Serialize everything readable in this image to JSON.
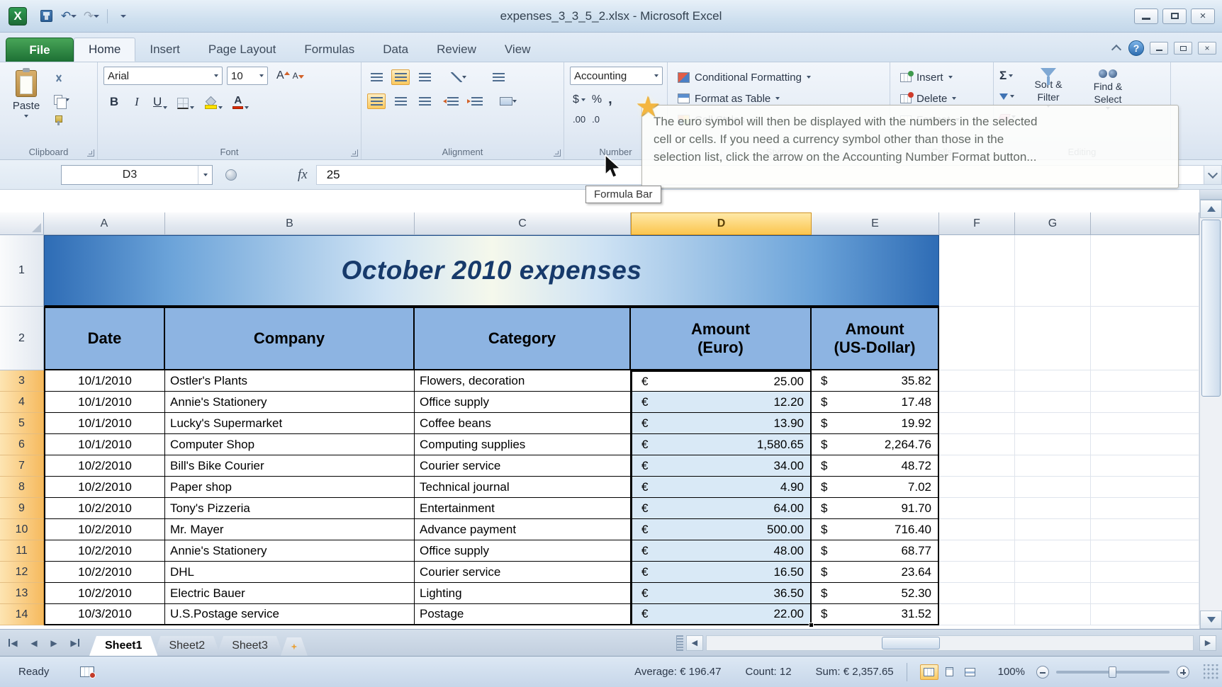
{
  "window": {
    "title": "expenses_3_3_5_2.xlsx  -  Microsoft Excel"
  },
  "tabs": {
    "file": "File",
    "items": [
      "Home",
      "Insert",
      "Page Layout",
      "Formulas",
      "Data",
      "Review",
      "View"
    ]
  },
  "ribbon": {
    "clipboard": {
      "paste": "Paste",
      "label": "Clipboard"
    },
    "font": {
      "name": "Arial",
      "size": "10",
      "bold": "B",
      "italic": "I",
      "underline": "U",
      "label": "Font"
    },
    "alignment": {
      "label": "Alignment"
    },
    "number": {
      "format": "Accounting",
      "currency": "$",
      "percent": "%",
      "comma": ",",
      "inc_decimal": ".00",
      "dec_decimal": ".0",
      "label": "Number"
    },
    "styles": {
      "conditional": "Conditional Formatting",
      "format_table": "Format as Table",
      "cell_styles": "Cell Styles",
      "label": "Styles"
    },
    "cells": {
      "insert": "Insert",
      "delete": "Delete",
      "format": "Format",
      "label": "Cells"
    },
    "editing": {
      "sort_line1": "Sort &",
      "sort_line2": "Filter",
      "find_line1": "Find &",
      "find_line2": "Select",
      "label": "Editing"
    }
  },
  "tip_overlay": {
    "line1": "The euro symbol will then be displayed with the numbers in the selected",
    "line2": "cell or cells. If you need a currency symbol other than those in the",
    "line3": "selection list, click the arrow on the Accounting Number Format button..."
  },
  "formula_bar": {
    "name_box": "D3",
    "fx": "fx",
    "value": "25",
    "tooltip": "Formula Bar"
  },
  "grid": {
    "columns": [
      "A",
      "B",
      "C",
      "D",
      "E",
      "F",
      "G"
    ],
    "title_row": {
      "n": "1",
      "text": "October 2010 expenses"
    },
    "header_row": {
      "n": "2",
      "date": "Date",
      "company": "Company",
      "category": "Category",
      "euro_line1": "Amount",
      "euro_line2": "(Euro)",
      "usd_line1": "Amount",
      "usd_line2": "(US-Dollar)"
    },
    "rows": [
      {
        "n": "3",
        "date": "10/1/2010",
        "company": "Ostler's Plants",
        "category": "Flowers, decoration",
        "eur_sym": "€",
        "eur": "25.00",
        "usd_sym": "$",
        "usd": "35.82"
      },
      {
        "n": "4",
        "date": "10/1/2010",
        "company": "Annie's Stationery",
        "category": "Office supply",
        "eur_sym": "€",
        "eur": "12.20",
        "usd_sym": "$",
        "usd": "17.48"
      },
      {
        "n": "5",
        "date": "10/1/2010",
        "company": "Lucky's Supermarket",
        "category": "Coffee beans",
        "eur_sym": "€",
        "eur": "13.90",
        "usd_sym": "$",
        "usd": "19.92"
      },
      {
        "n": "6",
        "date": "10/1/2010",
        "company": "Computer Shop",
        "category": "Computing supplies",
        "eur_sym": "€",
        "eur": "1,580.65",
        "usd_sym": "$",
        "usd": "2,264.76"
      },
      {
        "n": "7",
        "date": "10/2/2010",
        "company": "Bill's Bike Courier",
        "category": "Courier service",
        "eur_sym": "€",
        "eur": "34.00",
        "usd_sym": "$",
        "usd": "48.72"
      },
      {
        "n": "8",
        "date": "10/2/2010",
        "company": "Paper shop",
        "category": "Technical journal",
        "eur_sym": "€",
        "eur": "4.90",
        "usd_sym": "$",
        "usd": "7.02"
      },
      {
        "n": "9",
        "date": "10/2/2010",
        "company": "Tony's Pizzeria",
        "category": "Entertainment",
        "eur_sym": "€",
        "eur": "64.00",
        "usd_sym": "$",
        "usd": "91.70"
      },
      {
        "n": "10",
        "date": "10/2/2010",
        "company": "Mr. Mayer",
        "category": "Advance payment",
        "eur_sym": "€",
        "eur": "500.00",
        "usd_sym": "$",
        "usd": "716.40"
      },
      {
        "n": "11",
        "date": "10/2/2010",
        "company": "Annie's Stationery",
        "category": "Office supply",
        "eur_sym": "€",
        "eur": "48.00",
        "usd_sym": "$",
        "usd": "68.77"
      },
      {
        "n": "12",
        "date": "10/2/2010",
        "company": "DHL",
        "category": "Courier service",
        "eur_sym": "€",
        "eur": "16.50",
        "usd_sym": "$",
        "usd": "23.64"
      },
      {
        "n": "13",
        "date": "10/2/2010",
        "company": "Electric Bauer",
        "category": "Lighting",
        "eur_sym": "€",
        "eur": "36.50",
        "usd_sym": "$",
        "usd": "52.30"
      },
      {
        "n": "14",
        "date": "10/3/2010",
        "company": "U.S.Postage service",
        "category": "Postage",
        "eur_sym": "€",
        "eur": "22.00",
        "usd_sym": "$",
        "usd": "31.52"
      }
    ]
  },
  "sheet_tabs": {
    "tabs": [
      "Sheet1",
      "Sheet2",
      "Sheet3"
    ]
  },
  "status_bar": {
    "ready": "Ready",
    "average": "Average:  € 196.47",
    "count": "Count: 12",
    "sum": "Sum:  € 2,357.65",
    "zoom": "100%"
  },
  "icons": {
    "undo": "↶",
    "redo": "↷",
    "close": "×",
    "help": "?",
    "star": "★",
    "autosum": "Σ",
    "grow_font": "A",
    "shrink_font": "A",
    "font_color": "A",
    "excel_logo": "X",
    "tri_left": "◀",
    "tri_right": "▶"
  }
}
